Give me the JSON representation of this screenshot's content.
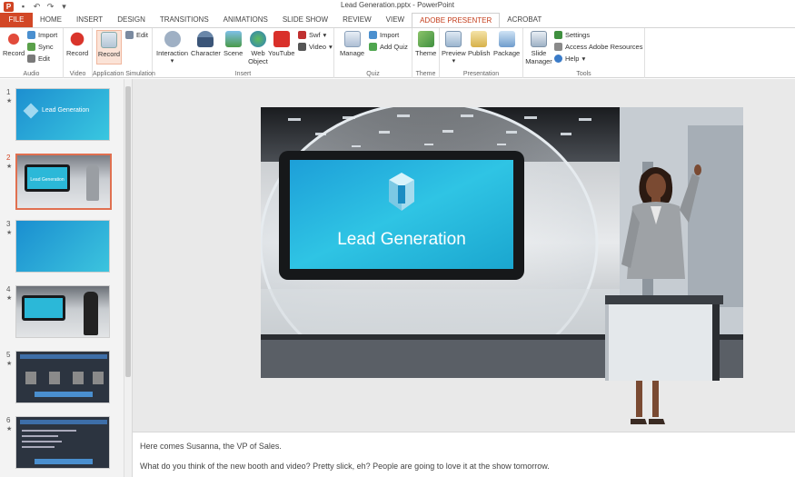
{
  "window": {
    "title": "Lead Generation.pptx - PowerPoint"
  },
  "qat": {
    "icons": [
      "save-icon",
      "undo-icon",
      "redo-icon",
      "customize-icon"
    ]
  },
  "tabs": [
    {
      "label": "FILE",
      "key": "file"
    },
    {
      "label": "HOME",
      "key": "home"
    },
    {
      "label": "INSERT",
      "key": "insert"
    },
    {
      "label": "DESIGN",
      "key": "design"
    },
    {
      "label": "TRANSITIONS",
      "key": "transitions"
    },
    {
      "label": "ANIMATIONS",
      "key": "animations"
    },
    {
      "label": "SLIDE SHOW",
      "key": "slideshow"
    },
    {
      "label": "REVIEW",
      "key": "review"
    },
    {
      "label": "VIEW",
      "key": "view"
    },
    {
      "label": "ADOBE PRESENTER",
      "key": "presenter"
    },
    {
      "label": "ACROBAT",
      "key": "acrobat"
    }
  ],
  "ribbon": {
    "audio": {
      "label": "Audio",
      "record": "Record",
      "import": "Import",
      "sync": "Sync",
      "edit": "Edit"
    },
    "video": {
      "label": "Video",
      "record": "Record"
    },
    "appsim": {
      "label": "Application Simulation",
      "record": "Record",
      "edit": "Edit"
    },
    "insert": {
      "label": "Insert",
      "interaction": "Interaction",
      "character": "Character",
      "scene": "Scene",
      "web_object": "Web Object",
      "youtube": "YouTube",
      "swf": "Swf",
      "video": "Video"
    },
    "quiz": {
      "label": "Quiz",
      "manage": "Manage",
      "import": "Import",
      "add_quiz": "Add Quiz"
    },
    "theme": {
      "label": "Theme",
      "theme": "Theme"
    },
    "presentation": {
      "label": "Presentation",
      "preview": "Preview",
      "publish": "Publish",
      "package": "Package"
    },
    "tools": {
      "label": "Tools",
      "slide_manager": "Slide Manager",
      "settings": "Settings",
      "resources": "Access Adobe Resources",
      "help": "Help"
    }
  },
  "slides": [
    {
      "num": "1",
      "star": "★",
      "caption": "Lead Generation"
    },
    {
      "num": "2",
      "star": "★",
      "caption": "Lead Generation"
    },
    {
      "num": "3",
      "star": "★",
      "caption": ""
    },
    {
      "num": "4",
      "star": "★",
      "caption": ""
    },
    {
      "num": "5",
      "star": "★",
      "caption": ""
    },
    {
      "num": "6",
      "star": "★",
      "caption": ""
    }
  ],
  "main_slide": {
    "title": "Lead Generation"
  },
  "notes": {
    "line1": "Here comes Susanna, the VP of Sales.",
    "line2": "What do you think of the new booth and video? Pretty slick, eh? People are going to love it at the show tomorrow."
  },
  "colors": {
    "accent": "#d24726",
    "slide_cyan": "#1fb8d8"
  }
}
